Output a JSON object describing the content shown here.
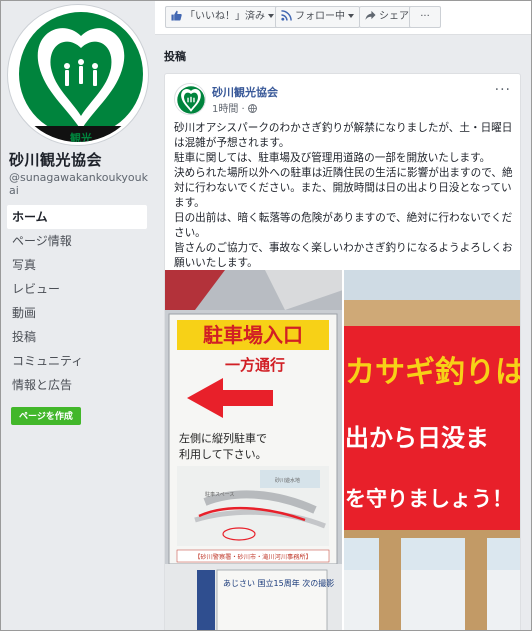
{
  "page": {
    "name": "砂川観光協会",
    "handle": "@sunagawakankoukyoukai"
  },
  "nav": {
    "items": [
      "ホーム",
      "ページ情報",
      "写真",
      "レビュー",
      "動画",
      "投稿",
      "コミュニティ",
      "情報と広告"
    ]
  },
  "create_page_label": "ページを作成",
  "actionbar": {
    "like_label": "「いいね！」済み",
    "follow_label": "フォロー中",
    "share_label": "シェア",
    "more_label": "···"
  },
  "posts_heading": "投稿",
  "post": {
    "author": "砂川観光協会",
    "time": "1時間 ·",
    "menu": "···",
    "paragraphs": [
      "砂川オアシスパークのわかさぎ釣りが解禁になりましたが、土・日曜日は混雑が予想されます。",
      "駐車に関しては、駐車場及び管理用道路の一部を開放いたします。",
      "決められた場所以外への駐車は近隣住民の生活に影響が出ますので、絶対に行わないでください。また、開放時間は日の出より日没となっています。",
      "日の出前は、暗く転落等の危険がありますので、絶対に行わないでください。",
      "皆さんのご協力で、事故なく楽しいわかさぎ釣りになるようよろしくお願いいたします。"
    ]
  },
  "photo": {
    "left_sign": {
      "title": "駐車場入口",
      "sub": "一方通行",
      "text1": "左側に縦列駐車で",
      "text2": "利用して下さい。",
      "map_label1": "駐車スペース",
      "map_label2": "砂川遊水地",
      "footer": "【砂川警察署・砂川市・滝川河川事務所】",
      "lower_text": "あじさい 国立15周年 次の撮影"
    },
    "right_sign": {
      "line1": "カサギ釣りは",
      "line2": "出から日没ま",
      "line3": "を守りましょう！"
    }
  },
  "colors": {
    "accent": "#4267b2",
    "logo_green": "#00843d",
    "sign_red": "#e8202a",
    "sign_yellow": "#f7d117"
  }
}
